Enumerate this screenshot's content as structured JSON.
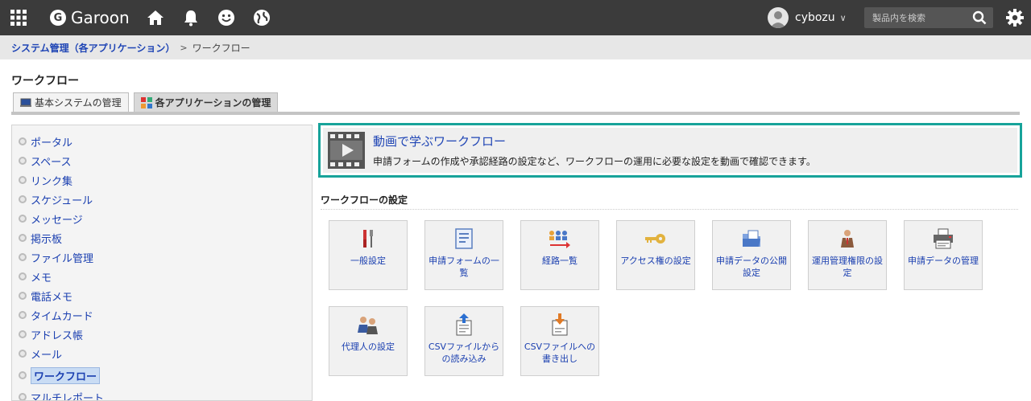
{
  "header": {
    "brand": "Garoon",
    "brand_initial": "G",
    "user_name": "cybozu",
    "search_placeholder": "製品内を検索"
  },
  "breadcrumb": {
    "parent": "システム管理（各アプリケーション）",
    "separator": ">",
    "current": "ワークフロー"
  },
  "page": {
    "title": "ワークフロー",
    "tabs": [
      {
        "label": "基本システムの管理"
      },
      {
        "label": "各アプリケーションの管理"
      }
    ]
  },
  "sidebar": {
    "items": [
      {
        "label": "ポータル"
      },
      {
        "label": "スペース"
      },
      {
        "label": "リンク集"
      },
      {
        "label": "スケジュール"
      },
      {
        "label": "メッセージ"
      },
      {
        "label": "掲示板"
      },
      {
        "label": "ファイル管理"
      },
      {
        "label": "メモ"
      },
      {
        "label": "電話メモ"
      },
      {
        "label": "タイムカード"
      },
      {
        "label": "アドレス帳"
      },
      {
        "label": "メール"
      },
      {
        "label": "ワークフロー"
      },
      {
        "label": "マルチレポート"
      }
    ]
  },
  "banner": {
    "title": "動画で学ぶワークフロー",
    "description": "申請フォームの作成や承認経路の設定など、ワークフローの運用に必要な設定を動画で確認できます。"
  },
  "settings": {
    "title": "ワークフローの設定",
    "tiles": [
      {
        "label": "一般設定",
        "icon": "tools-icon"
      },
      {
        "label": "申請フォームの一覧",
        "icon": "form-icon"
      },
      {
        "label": "経路一覧",
        "icon": "route-icon"
      },
      {
        "label": "アクセス権の設定",
        "icon": "key-icon"
      },
      {
        "label": "申請データの公開設定",
        "icon": "folder-icon"
      },
      {
        "label": "運用管理権限の設定",
        "icon": "admin-icon"
      },
      {
        "label": "申請データの管理",
        "icon": "printer-icon"
      },
      {
        "label": "代理人の設定",
        "icon": "proxy-icon"
      },
      {
        "label": "CSVファイルからの読み込み",
        "icon": "csv-import-icon"
      },
      {
        "label": "CSVファイルへの書き出し",
        "icon": "csv-export-icon"
      }
    ]
  },
  "colors": {
    "topbar": "#3b3b3b",
    "link": "#1a3fb0",
    "banner_border": "#17a39a"
  }
}
